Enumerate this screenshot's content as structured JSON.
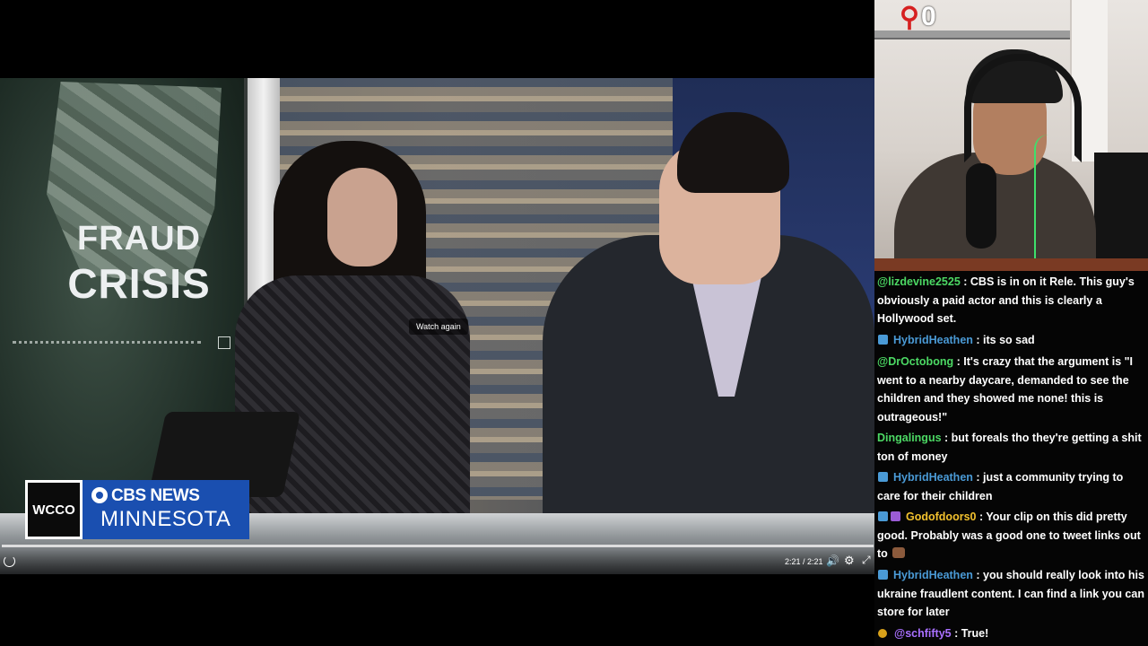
{
  "video": {
    "graphic_line1": "FRAUD",
    "graphic_line2": "CRISIS",
    "chyron_logo": "WCCO",
    "chyron_network": "CBS NEWS",
    "chyron_market": "MINNESOTA",
    "watch_again": "Watch again",
    "time": "2:21 / 2:21",
    "progress": 1.0
  },
  "webcam": {
    "alert_count": "0"
  },
  "chat": {
    "messages": [
      {
        "user": "@lizdevine2525",
        "color": "#4cd964",
        "badge": "",
        "text": " : CBS is in on it Rele. This guy's obviously a paid actor and this is clearly a Hollywood set."
      },
      {
        "user": "HybridHeathen",
        "color": "#4a9ad6",
        "badge": "blue",
        "text": " : its so sad"
      },
      {
        "user": "@DrOctobong",
        "color": "#4cd964",
        "badge": "",
        "text": " : It's crazy that the argument is \"I went to a nearby daycare, demanded to see the children and they showed me none! this is outrageous!\""
      },
      {
        "user": "Dingalingus",
        "color": "#4cd964",
        "badge": "",
        "text": " : but foreals tho they're getting a shit ton of money"
      },
      {
        "user": "HybridHeathen",
        "color": "#4a9ad6",
        "badge": "blue",
        "text": " : just a community trying to care for their children"
      },
      {
        "user": "Godofdoors0",
        "color": "#f2c12e",
        "badge": "blue-purple",
        "text": " : Your clip on this did pretty good. Probably was a good one to tweet links out to"
      },
      {
        "user": "HybridHeathen",
        "color": "#4a9ad6",
        "badge": "blue",
        "text": " : you should really look into his ukraine fraudlent content. I can find a link you can store for later"
      },
      {
        "user": "@schfifty5",
        "color": "#a970ff",
        "badge": "gold",
        "text": " : True!"
      }
    ]
  }
}
